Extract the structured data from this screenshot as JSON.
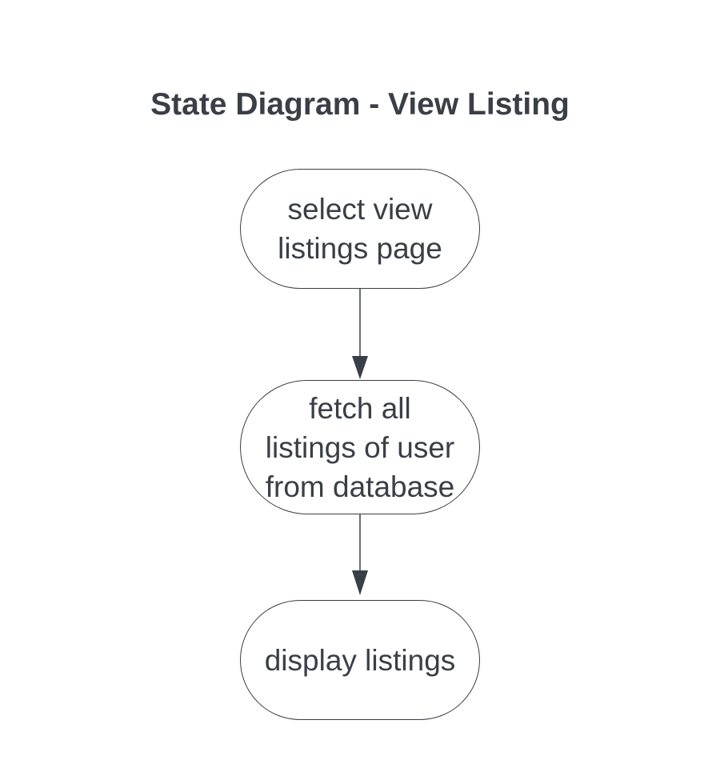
{
  "diagram": {
    "title": "State Diagram - View Listing",
    "states": [
      {
        "id": "s1",
        "label": "select view\nlistings page"
      },
      {
        "id": "s2",
        "label": "fetch all\nlistings of user\nfrom database"
      },
      {
        "id": "s3",
        "label": "display listings"
      }
    ],
    "transitions": [
      {
        "from": "s1",
        "to": "s2"
      },
      {
        "from": "s2",
        "to": "s3"
      }
    ],
    "colors": {
      "stroke": "#3a3f47",
      "text": "#3a3f47",
      "background": "#ffffff"
    }
  }
}
